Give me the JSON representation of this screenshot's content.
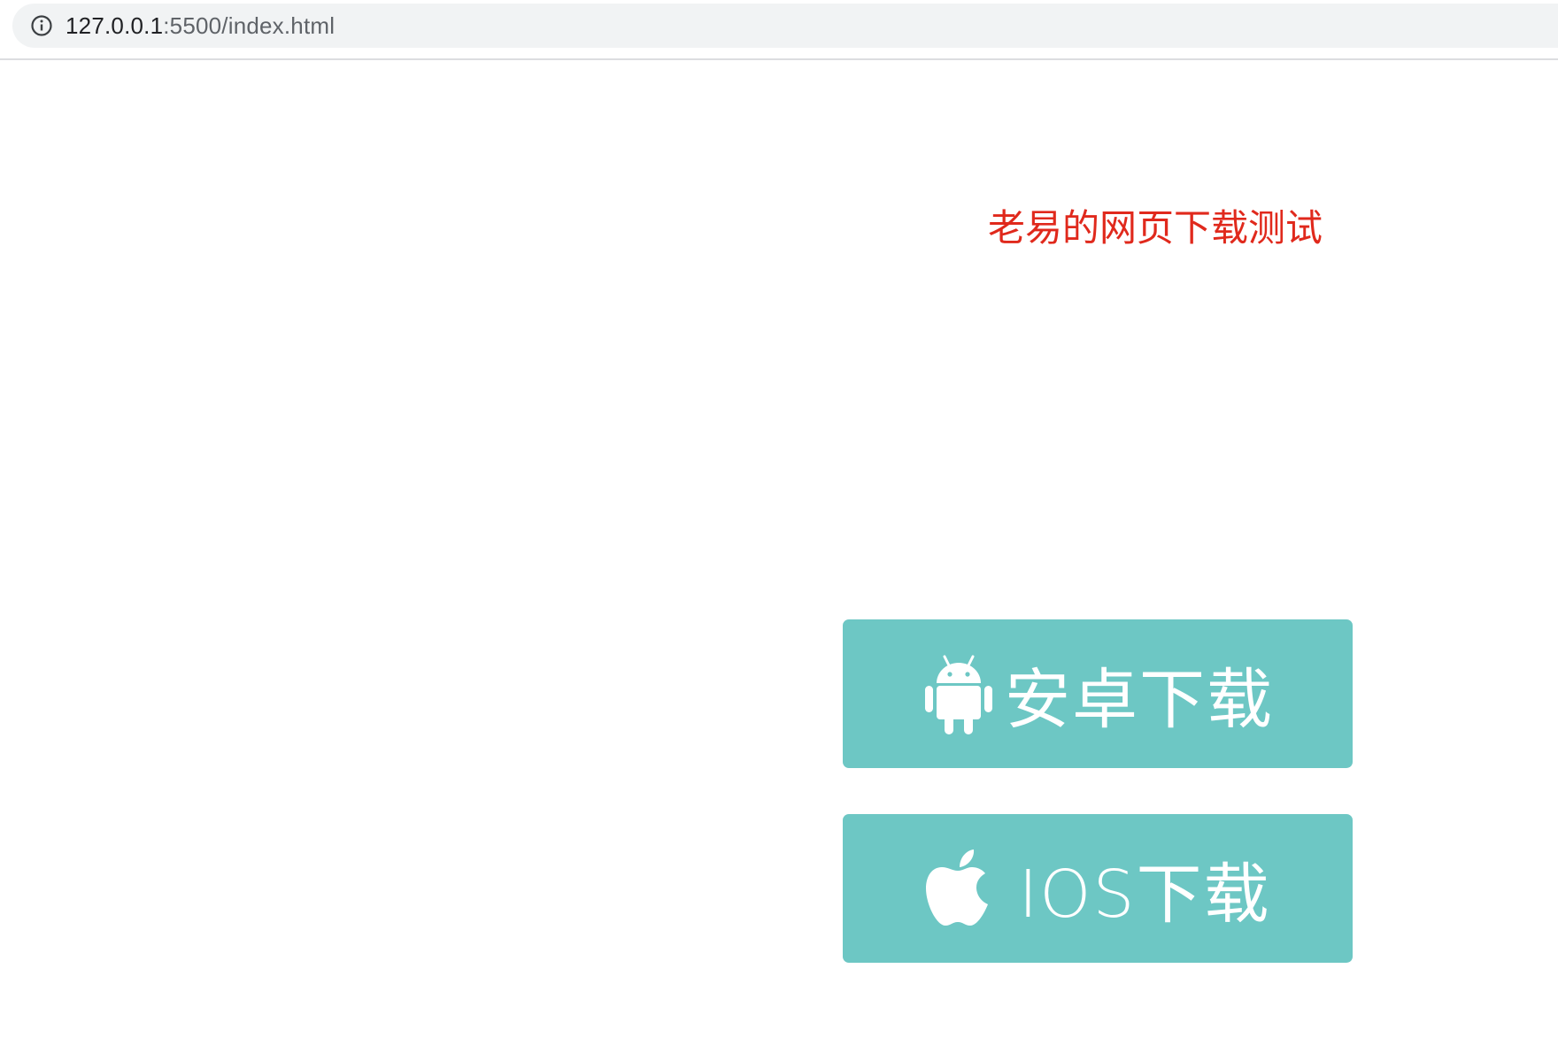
{
  "browser": {
    "url_host": "127.0.0.1",
    "url_rest": ":5500/index.html"
  },
  "page": {
    "title": "老易的网页下载测试",
    "android_button": {
      "label": "安卓下载",
      "icon": "android-icon"
    },
    "ios_button": {
      "label": "IOS下载",
      "icon": "apple-icon"
    }
  },
  "colors": {
    "title": "#e0291c",
    "button_bg": "#6dc7c4",
    "button_text": "#ffffff"
  }
}
